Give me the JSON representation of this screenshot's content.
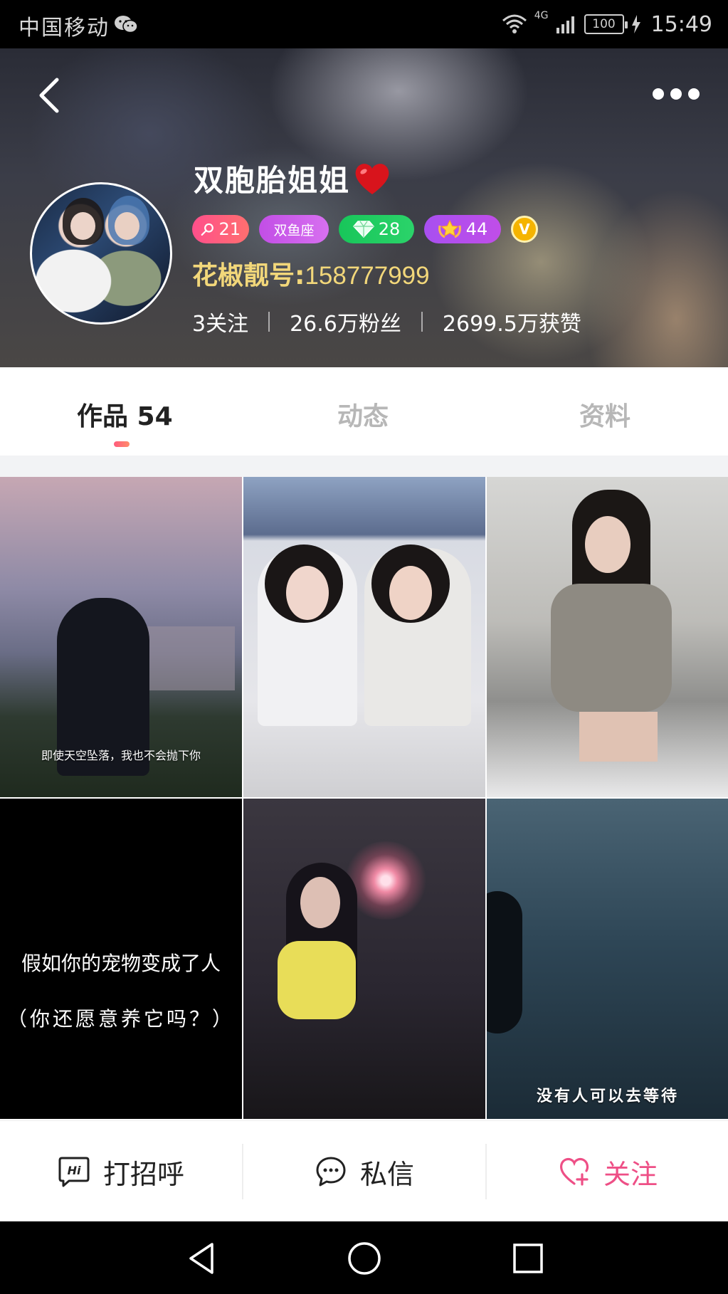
{
  "status_bar": {
    "carrier": "中国移动",
    "network": "4G",
    "battery": "100",
    "time": "15:49"
  },
  "profile": {
    "nickname": "双胞胎姐姐",
    "badges": {
      "level": "21",
      "zodiac": "双鱼座",
      "gems": "28",
      "stars": "44",
      "verified": "V"
    },
    "hj_id_label": "花椒靓号:",
    "hj_id": "158777999",
    "stats": {
      "following": "3关注",
      "fans": "26.6万粉丝",
      "likes": "2699.5万获赞"
    }
  },
  "tabs": {
    "works": "作品 54",
    "dynamic": "动态",
    "info": "资料",
    "active": "works"
  },
  "grid": {
    "captions": {
      "cell1": "即使天空坠落，我也不会抛下你",
      "cell4_line1": "假如你的宠物变成了人",
      "cell4_line2": "（你还愿意养它吗？）",
      "cell6": "没有人可以去等待"
    }
  },
  "actions": {
    "greet": "打招呼",
    "message": "私信",
    "follow": "关注"
  },
  "colors": {
    "accent": "#ee4f86",
    "id_gold": "#f2d77a",
    "tab_indicator": "#ff5b7d"
  }
}
